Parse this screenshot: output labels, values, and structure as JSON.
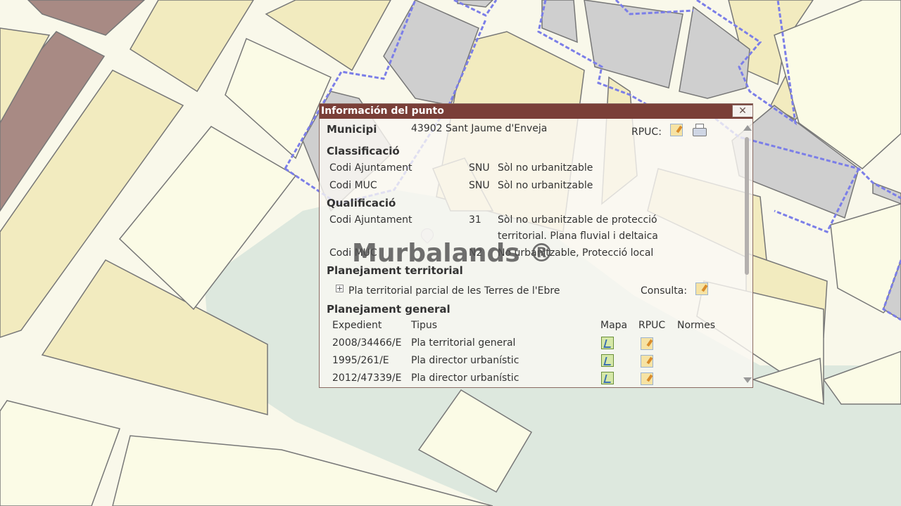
{
  "popup": {
    "title": "Información del punto",
    "close": "✕",
    "municipi_label": "Municipi",
    "municipi_value": "43902 Sant Jaume d'Enveja",
    "rpuc_label": "RPUC:",
    "classificacio": {
      "heading": "Classificació",
      "rows": [
        {
          "label": "Codi Ajuntament",
          "code": "SNU",
          "desc": "Sòl no urbanitzable"
        },
        {
          "label": "Codi MUC",
          "code": "SNU",
          "desc": "Sòl no urbanitzable"
        }
      ]
    },
    "qualificacio": {
      "heading": "Qualificació",
      "rows": [
        {
          "label": "Codi Ajuntament",
          "code": "31",
          "desc1": "Sòl no urbanitzable de protecció",
          "desc2": "territorial. Plana fluvial i deltaica"
        },
        {
          "label": "Codi MUC",
          "code": "N2",
          "desc1": "No urbanitzable, Protecció local"
        }
      ]
    },
    "planejament_territorial": {
      "heading": "Planejament territorial",
      "item": "Pla territorial parcial de les Terres de l'Ebre",
      "consulta_label": "Consulta:"
    },
    "planejament_general": {
      "heading": "Planejament general",
      "columns": [
        "Expedient",
        "Tipus",
        "Mapa",
        "RPUC",
        "Normes"
      ],
      "rows": [
        {
          "expedient": "2008/34466/E",
          "tipus": "Pla territorial general"
        },
        {
          "expedient": "1995/261/E",
          "tipus": "Pla director urbanístic"
        },
        {
          "expedient": "2012/47339/E",
          "tipus": "Pla director urbanístic"
        }
      ]
    }
  },
  "watermark": "Murbalands ®",
  "colors": {
    "title_bar": "#7a3f38",
    "parcel_beige": "#f2ebbf",
    "parcel_cream": "#fbfbe6",
    "parcel_brown": "#a88a84",
    "parcel_gray": "#cfcfcf",
    "water_green": "#dde8de",
    "boundary": "#7b7ee8"
  }
}
